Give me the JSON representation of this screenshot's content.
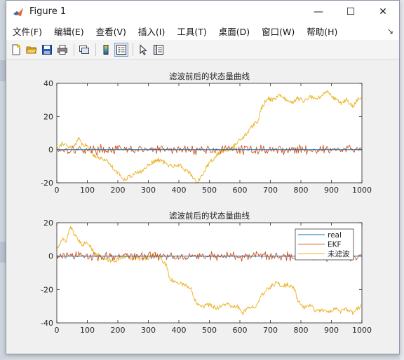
{
  "window": {
    "title": "Figure 1",
    "controls": {
      "minimize": "—",
      "maximize": "☐",
      "close": "✕"
    }
  },
  "menu": {
    "items": [
      "文件(F)",
      "编辑(E)",
      "查看(V)",
      "插入(I)",
      "工具(T)",
      "桌面(D)",
      "窗口(W)",
      "帮助(H)"
    ],
    "overflow_arrow": "↘"
  },
  "toolbar": {
    "buttons": [
      "new-figure-icon",
      "open-folder-icon",
      "save-icon",
      "print-icon",
      "link-plot-icon",
      "colorbar-icon",
      "legend-icon",
      "pointer-icon",
      "property-editor-icon"
    ]
  },
  "colors": {
    "real": "#0072bd",
    "ekf": "#d95319",
    "unfiltered": "#edb120",
    "axes_bg": "#ffffff",
    "figure_bg": "#f0f0f0"
  },
  "chart_data": [
    {
      "type": "line",
      "title": "滤波前后的状态量曲线",
      "xlim": [
        0,
        1000
      ],
      "ylim": [
        -20,
        40
      ],
      "xticks": [
        "0",
        "100",
        "200",
        "300",
        "400",
        "500",
        "600",
        "700",
        "800",
        "900",
        "1000"
      ],
      "yticks": [
        "-20",
        "0",
        "20",
        "40"
      ],
      "series": [
        {
          "key": "real",
          "points": [
            [
              0,
              0
            ],
            [
              1000,
              0
            ]
          ]
        },
        {
          "key": "ekf",
          "noise_amplitude": 2
        },
        {
          "key": "unfiltered",
          "points": [
            [
              0,
              1
            ],
            [
              20,
              4
            ],
            [
              40,
              1
            ],
            [
              60,
              3
            ],
            [
              70,
              7
            ],
            [
              80,
              4
            ],
            [
              100,
              2
            ],
            [
              120,
              -3
            ],
            [
              140,
              -5
            ],
            [
              160,
              -6
            ],
            [
              180,
              -10
            ],
            [
              200,
              -14
            ],
            [
              220,
              -18
            ],
            [
              240,
              -16
            ],
            [
              260,
              -14
            ],
            [
              280,
              -13
            ],
            [
              300,
              -9
            ],
            [
              320,
              -7
            ],
            [
              340,
              -6
            ],
            [
              360,
              -9
            ],
            [
              380,
              -10
            ],
            [
              400,
              -9
            ],
            [
              420,
              -12
            ],
            [
              440,
              -15
            ],
            [
              460,
              -20
            ],
            [
              480,
              -14
            ],
            [
              500,
              -8
            ],
            [
              520,
              -4
            ],
            [
              540,
              -1
            ],
            [
              560,
              0
            ],
            [
              580,
              2
            ],
            [
              600,
              6
            ],
            [
              620,
              9
            ],
            [
              640,
              14
            ],
            [
              660,
              17
            ],
            [
              670,
              25
            ],
            [
              690,
              31
            ],
            [
              710,
              30
            ],
            [
              730,
              33
            ],
            [
              750,
              30
            ],
            [
              770,
              28
            ],
            [
              790,
              31
            ],
            [
              810,
              29
            ],
            [
              830,
              32
            ],
            [
              850,
              30
            ],
            [
              870,
              33
            ],
            [
              890,
              35
            ],
            [
              910,
              31
            ],
            [
              930,
              28
            ],
            [
              950,
              30
            ],
            [
              970,
              26
            ],
            [
              985,
              30
            ],
            [
              1000,
              31
            ]
          ]
        }
      ]
    },
    {
      "type": "line",
      "title": "滤波前后的状态量曲线",
      "xlim": [
        0,
        1000
      ],
      "ylim": [
        -40,
        20
      ],
      "xticks": [
        "0",
        "100",
        "200",
        "300",
        "400",
        "500",
        "600",
        "700",
        "800",
        "900",
        "1000"
      ],
      "yticks": [
        "-40",
        "-20",
        "0",
        "20"
      ],
      "legend": {
        "position": "top-right",
        "entries": [
          "real",
          "EKF",
          "未滤波"
        ]
      },
      "series": [
        {
          "key": "real",
          "points": [
            [
              0,
              0
            ],
            [
              1000,
              0
            ]
          ]
        },
        {
          "key": "ekf",
          "noise_amplitude": 2
        },
        {
          "key": "unfiltered",
          "points": [
            [
              0,
              4
            ],
            [
              20,
              10
            ],
            [
              30,
              9
            ],
            [
              45,
              18
            ],
            [
              60,
              12
            ],
            [
              80,
              7
            ],
            [
              100,
              8
            ],
            [
              120,
              3
            ],
            [
              140,
              0
            ],
            [
              160,
              -2
            ],
            [
              180,
              -3
            ],
            [
              200,
              -2
            ],
            [
              220,
              0
            ],
            [
              240,
              -1
            ],
            [
              260,
              -1
            ],
            [
              280,
              -2
            ],
            [
              300,
              -1
            ],
            [
              320,
              1
            ],
            [
              340,
              -1
            ],
            [
              360,
              -6
            ],
            [
              370,
              -13
            ],
            [
              380,
              -15
            ],
            [
              400,
              -16
            ],
            [
              420,
              -17
            ],
            [
              440,
              -20
            ],
            [
              450,
              -25
            ],
            [
              460,
              -28
            ],
            [
              480,
              -30
            ],
            [
              500,
              -29
            ],
            [
              520,
              -31
            ],
            [
              540,
              -30
            ],
            [
              560,
              -28
            ],
            [
              570,
              -31
            ],
            [
              590,
              -30
            ],
            [
              610,
              -34
            ],
            [
              630,
              -31
            ],
            [
              650,
              -30
            ],
            [
              670,
              -24
            ],
            [
              690,
              -20
            ],
            [
              710,
              -17
            ],
            [
              720,
              -16
            ],
            [
              740,
              -18
            ],
            [
              760,
              -17
            ],
            [
              780,
              -20
            ],
            [
              790,
              -27
            ],
            [
              810,
              -31
            ],
            [
              830,
              -29
            ],
            [
              850,
              -33
            ],
            [
              870,
              -32
            ],
            [
              890,
              -34
            ],
            [
              910,
              -31
            ],
            [
              930,
              -33
            ],
            [
              950,
              -32
            ],
            [
              970,
              -34
            ],
            [
              990,
              -31
            ],
            [
              1000,
              -29
            ]
          ]
        }
      ]
    }
  ]
}
